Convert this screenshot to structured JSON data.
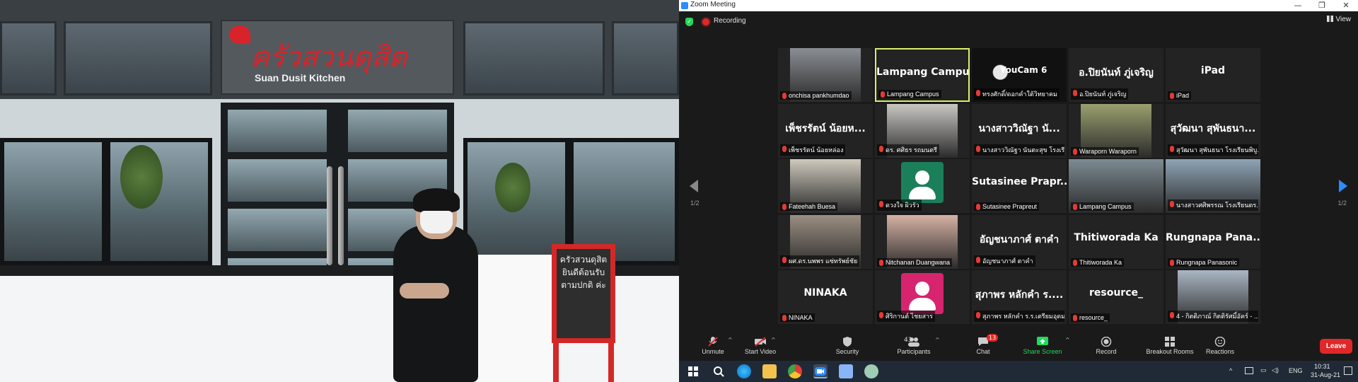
{
  "window": {
    "title": "Zoom Meeting",
    "controls": {
      "minimize": "—",
      "restore": "❐",
      "close": "✕"
    }
  },
  "topbar": {
    "recording": "Recording",
    "view": "View"
  },
  "shared_video": {
    "sign_thai": "ครัวสวนดุสิต",
    "sign_english": "Suan Dusit Kitchen",
    "board_text": "ครัวสวนดุสิต ยินดีต้อนรับ ตามปกติ ค่ะ"
  },
  "participants_page": {
    "left": "1/2",
    "right": "1/2"
  },
  "tiles": [
    {
      "name": "",
      "label": "onchisa pankhumdao",
      "type": "photo",
      "color": "#8a8f95",
      "active": false
    },
    {
      "name": "Lampang Campus",
      "label": "Lampang Campus",
      "type": "text",
      "active": true
    },
    {
      "name": "YouCam 6",
      "label": "ทรงศักดิ์/ดอกคำใต้วิทยาคม",
      "type": "youcam",
      "active": false
    },
    {
      "name": "อ.ปิยนันท์ ภู่เจริญ",
      "label": "อ.ปิยนันท์ ภู่เจริญ",
      "type": "text",
      "active": false
    },
    {
      "name": "iPad",
      "label": "iPad",
      "type": "text",
      "active": false
    },
    {
      "name": "เพ็ชรรัตน์ น้อยห...",
      "label": "เพ็ชรรัตน์ น้อยหล่อง",
      "type": "text",
      "active": false
    },
    {
      "name": "",
      "label": "ดร. ศศิธร รถมนตรี",
      "type": "photo",
      "color": "#c9c7c2",
      "active": false
    },
    {
      "name": "นางสาววิณัฐา นั...",
      "label": "นางสาววิณัฐา นันตะสุข โรงเรี...",
      "type": "text",
      "active": false
    },
    {
      "name": "",
      "label": "Waraporn Waraporn",
      "type": "photo",
      "color": "#9aa06e",
      "active": false
    },
    {
      "name": "สุวัฒนา สุพันธนา...",
      "label": "สุวัฒนา สุพันธนา โรงเรียนพิบู...",
      "type": "text",
      "active": false
    },
    {
      "name": "",
      "label": "Fateehah  Buesa",
      "type": "photo",
      "color": "#cfc9bd",
      "active": false
    },
    {
      "name": "",
      "label": "ดวงใจ ผิวรัว",
      "type": "avatar",
      "color": "#1b7f5a",
      "active": false
    },
    {
      "name": "Sutasinee  Prapr...",
      "label": "Sutasinee Prapreut",
      "type": "text",
      "active": false
    },
    {
      "name": "",
      "label": "Lampang Campus",
      "type": "photo_wide",
      "color": "#7d8c93",
      "active": false
    },
    {
      "name": "",
      "label": "นางสาวศศิพรรณ  โรงเรียนตร...",
      "type": "photo_wide",
      "color": "#8fa4b6",
      "active": false
    },
    {
      "name": "",
      "label": "ผศ.ดร.นพพร แซ่ทรัพย์ชัย",
      "type": "photo",
      "color": "#9b8e82",
      "active": false
    },
    {
      "name": "",
      "label": "Nitchanan Duangwana",
      "type": "photo",
      "color": "#d6b2a4",
      "active": false
    },
    {
      "name": "อัญชนาภาศ์  ตาคำ",
      "label": "อัญชนาภาศ์ ตาคำ",
      "type": "text",
      "active": false
    },
    {
      "name": "Thitiworada Ka",
      "label": "Thitiworada Ka",
      "type": "text",
      "active": false
    },
    {
      "name": "Rungnapa  Pana...",
      "label": "Rungnapa Panasonic",
      "type": "text",
      "active": false
    },
    {
      "name": "NINAKA",
      "label": "NINAKA",
      "type": "text",
      "active": false
    },
    {
      "name": "",
      "label": "ศิริกานต์ ไชยสาร",
      "type": "avatar",
      "color": "#d6256e",
      "active": false
    },
    {
      "name": "สุภาพร หลักคำ ร....",
      "label": "สุภาพร หลักคำ ร.ร.เตรียมอุดม...",
      "type": "text",
      "active": false
    },
    {
      "name": "resource_",
      "label": "resource_",
      "type": "text",
      "active": false
    },
    {
      "name": "",
      "label": "4 - กิตติภาณ์ กิตติรัศมิ์อัคร์ - ...",
      "type": "photo",
      "color": "#aab6c3",
      "active": false
    }
  ],
  "toolbar": {
    "unmute": "Unmute",
    "start_video": "Start Video",
    "security": "Security",
    "participants": "Participants",
    "participant_count": "43",
    "chat": "Chat",
    "chat_badge": "13",
    "share_screen": "Share Screen",
    "record": "Record",
    "breakout_rooms": "Breakout Rooms",
    "reactions": "Reactions",
    "leave": "Leave",
    "caret": "^"
  },
  "taskbar": {
    "language": "ENG",
    "time": "10:31",
    "date": "31-Aug-21",
    "tray_caret": "^"
  },
  "colors": {
    "zoom_blue": "#2d8cff",
    "leave_red": "#e02828",
    "active_speaker": "#d7f06b",
    "share_green": "#23d959"
  }
}
